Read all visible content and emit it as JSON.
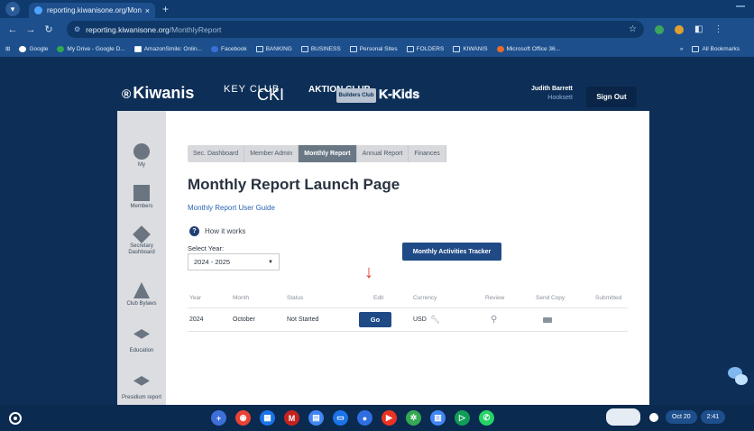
{
  "browser": {
    "tab_title": "reporting.kiwanisone.org/Mon",
    "tab_close": "×",
    "new_tab": "+",
    "url_host": "reporting.kiwanisone.org",
    "url_path": "/MonthlyReport",
    "bookmarks": [
      "Google",
      "My Drive - Google D...",
      "AmazonSmile: Onlin...",
      "Facebook",
      "BANKING",
      "BUSINESS",
      "Personal Sites",
      "FOLDERS",
      "KIWANIS",
      "Microsoft Office 36..."
    ],
    "bookmarks_more": "»",
    "all_bookmarks": "All Bookmarks"
  },
  "header": {
    "logo": "Kiwanis",
    "brand_key": "KEY CLUB",
    "brand_cki": "CKI",
    "brand_aktion": "AKTION CLUB",
    "brand_builders": "Builders Club",
    "brand_kkids": "K-Kids",
    "user_name": "Judith Barrett",
    "club_name": "Hooksett",
    "sign_out": "Sign Out"
  },
  "sidenav": [
    {
      "label": "My",
      "icon": "person-icon"
    },
    {
      "label": "Members",
      "icon": "members-icon"
    },
    {
      "label": "Secretary Dashboard",
      "icon": "gear-icon"
    },
    {
      "label": "Club Bylaws",
      "icon": "scales-icon"
    },
    {
      "label": "Education",
      "icon": "education-icon"
    },
    {
      "label": "Presidium report",
      "icon": "presidium-icon"
    }
  ],
  "tabs": [
    "Sec. Dashboard",
    "Member Admin",
    "Monthly Report",
    "Annual Report",
    "Finances"
  ],
  "active_tab": "Monthly Report",
  "page": {
    "title": "Monthly Report Launch Page",
    "guide_link": "Monthly Report User Guide",
    "how_it_works": "How it works",
    "select_label": "Select Year:",
    "select_value": "2024 - 2025",
    "tracker_button": "Monthly Activities Tracker"
  },
  "table": {
    "headers": [
      "Year",
      "Month",
      "Status",
      "Edit",
      "Currency",
      "Review",
      "Send Copy",
      "Submitted"
    ],
    "rows": [
      {
        "year": "2024",
        "month": "October",
        "status": "Not Started",
        "edit": "Go",
        "currency": "USD"
      }
    ]
  },
  "shelf": {
    "date": "Oct 20",
    "time": "2:41"
  },
  "colors": {
    "page_bg": "#0d2f57",
    "primary_button": "#1f4a86",
    "arrow": "#e2362b"
  }
}
